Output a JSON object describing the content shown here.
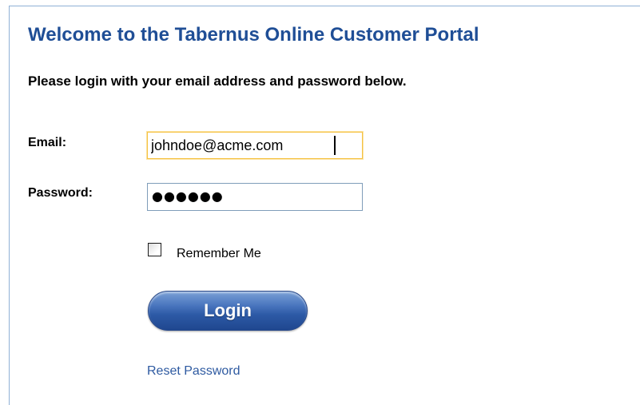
{
  "page": {
    "title": "Welcome to the Tabernus Online Customer Portal",
    "subtitle": "Please login with your email address and password below."
  },
  "form": {
    "email_label": "Email:",
    "email_value": "johndoe@acme.com",
    "password_label": "Password:",
    "password_masked": "●●●●●●",
    "remember_me_label": "Remember Me",
    "remember_me_checked": false,
    "login_label": "Login",
    "reset_password_label": "Reset Password"
  },
  "colors": {
    "title": "#1f4e96",
    "link": "#2e5aa1",
    "button": "#2d5aa6",
    "email_focus_border": "#f5c242",
    "input_border": "#7f9db9"
  }
}
